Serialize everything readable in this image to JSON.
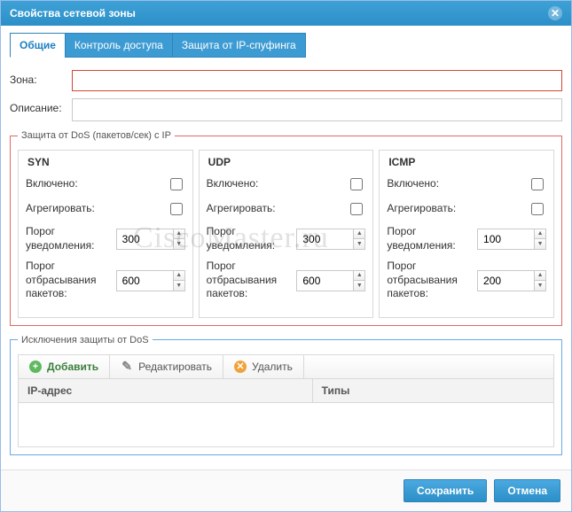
{
  "dialog": {
    "title": "Свойства сетевой зоны"
  },
  "tabs": {
    "general": "Общие",
    "access": "Контроль доступа",
    "spoof": "Защита от IP-спуфинга"
  },
  "form": {
    "zone_label": "Зона:",
    "zone_value": "",
    "desc_label": "Описание:",
    "desc_value": ""
  },
  "dos": {
    "legend": "Защита от DoS (пакетов/сек) с IP",
    "labels": {
      "enabled": "Включено:",
      "aggregate": "Агрегировать:",
      "alert_threshold": "Порог уведомления:",
      "drop_threshold": "Порог отбрасывания пакетов:"
    },
    "syn": {
      "title": "SYN",
      "alert": "300",
      "drop": "600"
    },
    "udp": {
      "title": "UDP",
      "alert": "300",
      "drop": "600"
    },
    "icmp": {
      "title": "ICMP",
      "alert": "100",
      "drop": "200"
    }
  },
  "excl": {
    "legend": "Исключения защиты от DoS",
    "add": "Добавить",
    "edit": "Редактировать",
    "del": "Удалить",
    "col_ip": "IP-адрес",
    "col_types": "Типы"
  },
  "buttons": {
    "save": "Сохранить",
    "cancel": "Отмена"
  },
  "watermark": "CiscoMaster.ru"
}
